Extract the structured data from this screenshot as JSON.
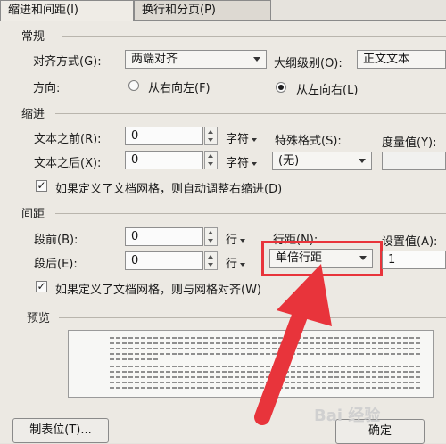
{
  "tabs": {
    "indent_spacing": "缩进和间距(I)",
    "line_page_break": "换行和分页(P)"
  },
  "general": {
    "title": "常规",
    "alignment_label": "对齐方式(G):",
    "alignment_value": "两端对齐",
    "outline_label": "大纲级别(O):",
    "outline_value": "正文文本",
    "direction_label": "方向:",
    "rtl_label": "从右向左(F)",
    "ltr_label": "从左向右(L)"
  },
  "indent": {
    "title": "缩进",
    "before_label": "文本之前(R):",
    "before_value": "0",
    "before_unit": "字符",
    "after_label": "文本之后(X):",
    "after_value": "0",
    "after_unit": "字符",
    "special_label": "特殊格式(S):",
    "special_value": "(无)",
    "measure_label": "度量值(Y):",
    "auto_adjust_label": "如果定义了文档网格，则自动调整右缩进(D)"
  },
  "spacing": {
    "title": "间距",
    "before_label": "段前(B):",
    "before_value": "0",
    "before_unit": "行",
    "after_label": "段后(E):",
    "after_value": "0",
    "after_unit": "行",
    "line_spacing_label": "行距(N):",
    "line_spacing_value": "单倍行距",
    "set_value_label": "设置值(A):",
    "set_value": "1",
    "snap_grid_label": "如果定义了文档网格，则与网格对齐(W)"
  },
  "preview": {
    "title": "预览"
  },
  "buttons": {
    "tabs_button": "制表位(T)...",
    "ok_button": "确定"
  },
  "watermark": "Bai 经验",
  "colors": {
    "highlight": "#e8343b",
    "arrow": "#e8343b"
  }
}
